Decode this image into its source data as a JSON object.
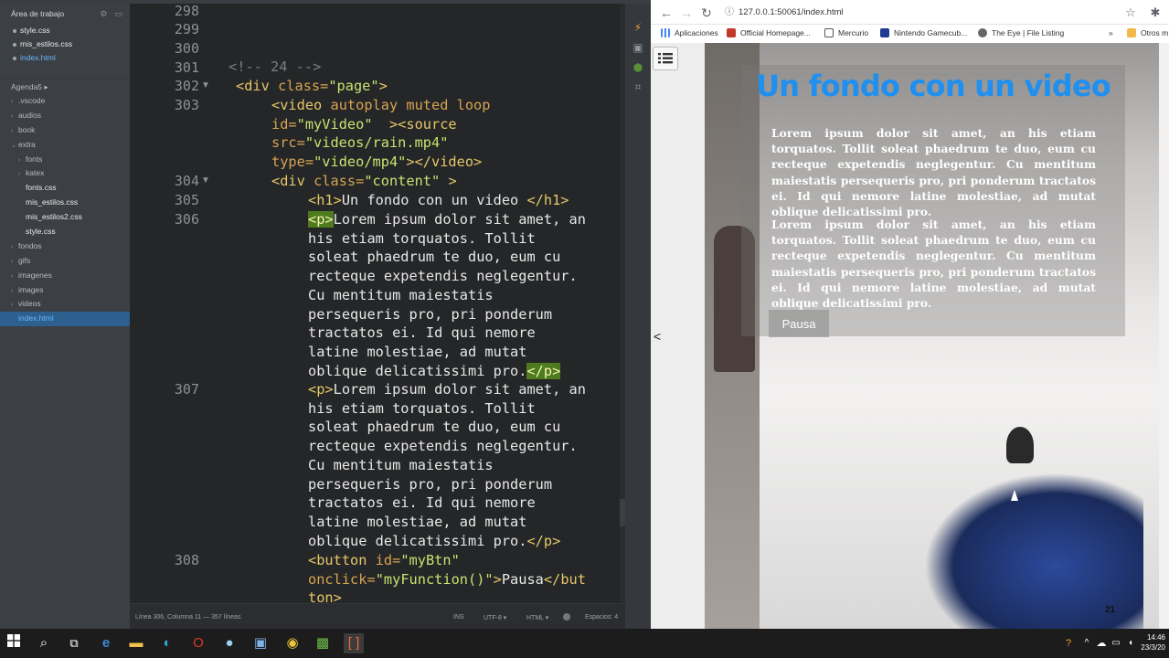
{
  "editor": {
    "sidebar": {
      "workspace_title": "Área de trabajo",
      "open_files": [
        {
          "name": "style.css",
          "active": false
        },
        {
          "name": "mis_estilos.css",
          "active": false
        },
        {
          "name": "index.html",
          "active": true
        }
      ],
      "agenda_title": "Agenda5 ▸",
      "tree": [
        {
          "label": ".vscode",
          "type": "folder",
          "depth": 0
        },
        {
          "label": "audios",
          "type": "folder",
          "depth": 0
        },
        {
          "label": "book",
          "type": "folder",
          "depth": 0
        },
        {
          "label": "extra",
          "type": "folder-open",
          "depth": 0
        },
        {
          "label": "fonts",
          "type": "folder",
          "depth": 1
        },
        {
          "label": "katex",
          "type": "folder",
          "depth": 1
        },
        {
          "label": "fonts.css",
          "type": "file",
          "depth": 1
        },
        {
          "label": "mis_estilos.css",
          "type": "file",
          "depth": 1
        },
        {
          "label": "mis_estilos2.css",
          "type": "file",
          "depth": 1
        },
        {
          "label": "style.css",
          "type": "file",
          "depth": 1
        },
        {
          "label": "fondos",
          "type": "folder",
          "depth": 0
        },
        {
          "label": "gifs",
          "type": "folder",
          "depth": 0
        },
        {
          "label": "imagenes",
          "type": "folder",
          "depth": 0
        },
        {
          "label": "images",
          "type": "folder",
          "depth": 0
        },
        {
          "label": "videos",
          "type": "folder",
          "depth": 0
        },
        {
          "label": "index.html",
          "type": "file",
          "depth": 0,
          "selected": true
        }
      ]
    },
    "line_numbers": [
      "298",
      "299",
      "300",
      "301",
      "302",
      "303",
      "304",
      "305",
      "306",
      "307",
      "308"
    ],
    "status": {
      "position": "Línea 306, Columna 11 — 357 líneas",
      "mode": "INS",
      "encoding": "UTF-8 ▾",
      "language": "HTML ▾",
      "spaces": "Espacios: 4"
    }
  },
  "browser": {
    "url": "127.0.0.1:50061/index.html",
    "bookmarks": [
      "Aplicaciones",
      "Official Homepage...",
      "Mercurio",
      "Nintendo Gamecub...",
      "The Eye | File Listing",
      "»",
      "Otros m"
    ],
    "page": {
      "title": "Un fondo con un video",
      "paragraph1": "Lorem ipsum dolor sit amet, an his etiam torquatos. Tollit soleat phaedrum te duo, eum cu recteque expetendis neglegentur. Cu mentitum maiestatis persequeris pro, pri ponderum tractatos ei. Id qui nemore latine molestiae, ad mutat oblique delicatissimi pro.",
      "paragraph2": "Lorem ipsum dolor sit amet, an his etiam torquatos. Tollit soleat phaedrum te duo, eum cu recteque expetendis neglegentur. Cu mentitum maiestatis persequeris pro, pri ponderum tractatos ei. Id qui nemore latine molestiae, ad mutat oblique delicatissimi pro.",
      "button_label": "Pausa",
      "video_corner_number": "21"
    }
  },
  "taskbar": {
    "time": "14:46",
    "date": "23/3/20"
  },
  "colors": {
    "editor_bg": "#242628",
    "sidebar_bg": "#3c3f43",
    "heading_blue": "#1f8ff0",
    "taskbar_bg": "#1c1c1c"
  }
}
